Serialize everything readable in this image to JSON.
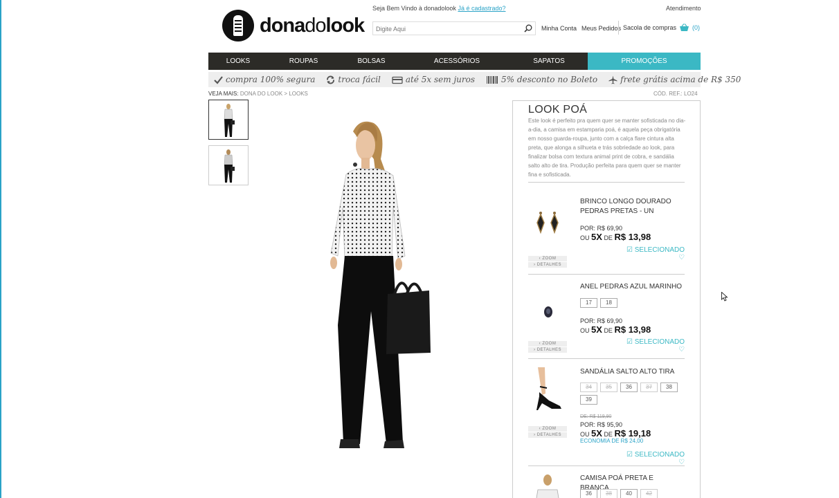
{
  "header": {
    "logo_bold": "dona",
    "logo_light": "do",
    "logo_bold2": "look",
    "welcome_text": "Seja Bem Vindo à donadolook",
    "welcome_link": "Já é cadastrado?",
    "atendimento": "Atendimento",
    "search_placeholder": "Digite Aqui",
    "minha_conta": "Minha Conta",
    "meus_pedidos": "Meus Pedidos",
    "cart_label": "Sacola de compras",
    "cart_count": "(0)"
  },
  "nav": [
    {
      "label": "LOOKS"
    },
    {
      "label": "ROUPAS"
    },
    {
      "label": "BOLSAS"
    },
    {
      "label": "ACESSÓRIOS"
    },
    {
      "label": "SAPATOS"
    },
    {
      "label": "PROMOÇÕES"
    }
  ],
  "benefits": [
    {
      "label": "compra 100% segura",
      "icon": "check-icon"
    },
    {
      "label": "troca fácil",
      "icon": "refresh-icon"
    },
    {
      "label": "até 5x sem juros",
      "icon": "credit-card-icon"
    },
    {
      "label": "5% desconto no Boleto",
      "icon": "barcode-icon"
    },
    {
      "label": "frete grátis acima de R$ 350",
      "icon": "airplane-icon"
    }
  ],
  "breadcrumb": {
    "prefix": "VEJA MAIS:",
    "home": "DONA DO LOOK",
    "sep": ">",
    "current": "LOOKS"
  },
  "product_code": "CÓD. REF.: LO24",
  "look": {
    "title": "LOOK POÁ",
    "description": "Este look é perfeito pra quem quer se manter sofisticada no dia-a-dia, a camisa em estamparia poá, é aquela peça obrigatória em nosso guarda-roupa, junto com a calça flare cintura alta preta, que alonga a silhueta e trás sobriedade ao look, para finalizar bolsa com textura animal print de cobra, e sandália salto alto de tira. Produção perfeita para quem quer se manter fina e sofisticada."
  },
  "items": [
    {
      "name": "BRINCO LONGO DOURADO PEDRAS PRETAS - UN",
      "sizes": [],
      "old_price": "",
      "price": "POR: R$ 69,90",
      "inst_ou": "OU",
      "inst_n": "5X",
      "inst_de": "DE",
      "inst_value": "R$ 13,98",
      "economy": "",
      "selected": "SELECIONADO"
    },
    {
      "name": "ANEL PEDRAS AZUL MARINHO",
      "sizes": [
        {
          "v": "17",
          "off": false
        },
        {
          "v": "18",
          "off": false
        }
      ],
      "old_price": "",
      "price": "POR: R$ 69,90",
      "inst_ou": "OU",
      "inst_n": "5X",
      "inst_de": "DE",
      "inst_value": "R$ 13,98",
      "economy": "",
      "selected": "SELECIONADO"
    },
    {
      "name": "SANDÁLIA SALTO ALTO TIRA",
      "sizes": [
        {
          "v": "34",
          "off": true
        },
        {
          "v": "35",
          "off": true
        },
        {
          "v": "36",
          "off": false
        },
        {
          "v": "37",
          "off": true
        },
        {
          "v": "38",
          "off": false
        },
        {
          "v": "39",
          "off": false
        }
      ],
      "old_price": "DE: R$ 119,90",
      "price": "POR: R$ 95,90",
      "inst_ou": "OU",
      "inst_n": "5X",
      "inst_de": "DE",
      "inst_value": "R$ 19,18",
      "economy": "ECONOMIA DE R$ 24,00",
      "selected": "SELECIONADO"
    },
    {
      "name": "CAMISA POÁ PRETA E BRANCA",
      "sizes": [
        {
          "v": "36",
          "off": false
        },
        {
          "v": "38",
          "off": true
        },
        {
          "v": "40",
          "off": false
        },
        {
          "v": "42",
          "off": true
        }
      ],
      "old_price": "",
      "price": "",
      "inst_ou": "",
      "inst_n": "",
      "inst_de": "",
      "inst_value": "",
      "economy": "",
      "selected": ""
    }
  ],
  "zoom": {
    "zoom": "‹ ZOOM",
    "details": "› DETALHES"
  },
  "colors": {
    "accent": "#3bb8c4",
    "nav_bg": "#2c2b27",
    "link": "#2aa3c7"
  }
}
